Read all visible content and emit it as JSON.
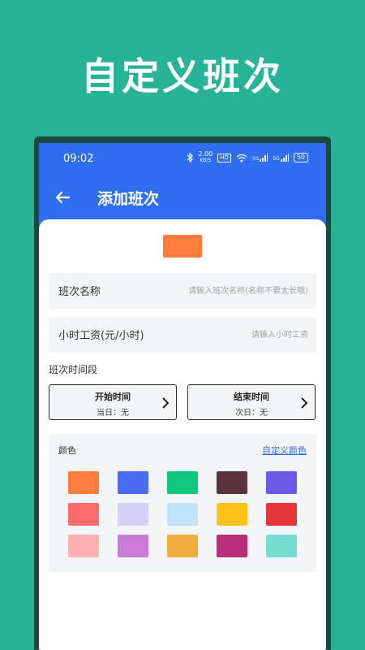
{
  "promo": {
    "title": "自定义班次"
  },
  "status_bar": {
    "time": "09:02",
    "speed_value": "2.00",
    "speed_unit": "KB/S",
    "hd": "HD",
    "signal_label_1": "5G",
    "signal_label_2": "5G",
    "battery": "50"
  },
  "app_bar": {
    "title": "添加班次"
  },
  "preview": {
    "color": "#ff7d3c"
  },
  "form": {
    "name_label": "班次名称",
    "name_placeholder": "请输入班次名称(名称不要太长哦)",
    "wage_label": "小时工资(元/小时)",
    "wage_placeholder": "请输入小时工资"
  },
  "period": {
    "label": "班次时间段",
    "start_title": "开始时间",
    "start_value": "当日：无",
    "end_title": "结束时间",
    "end_value": "次日：无"
  },
  "colors": {
    "label": "颜色",
    "custom_link": "自定义颜色",
    "swatches": [
      "#ff7d3c",
      "#4a6cf0",
      "#0fc77e",
      "#5a313c",
      "#6e58e8",
      "#ff6b6b",
      "#d6cff7",
      "#bfe3f8",
      "#ffc21c",
      "#e5363a",
      "#ffb0b0",
      "#c97ad6",
      "#f0ab3c",
      "#b8307c",
      "#76dcd2"
    ]
  },
  "theme": {
    "accent": "#2f6ef0",
    "background": "#27b396"
  }
}
